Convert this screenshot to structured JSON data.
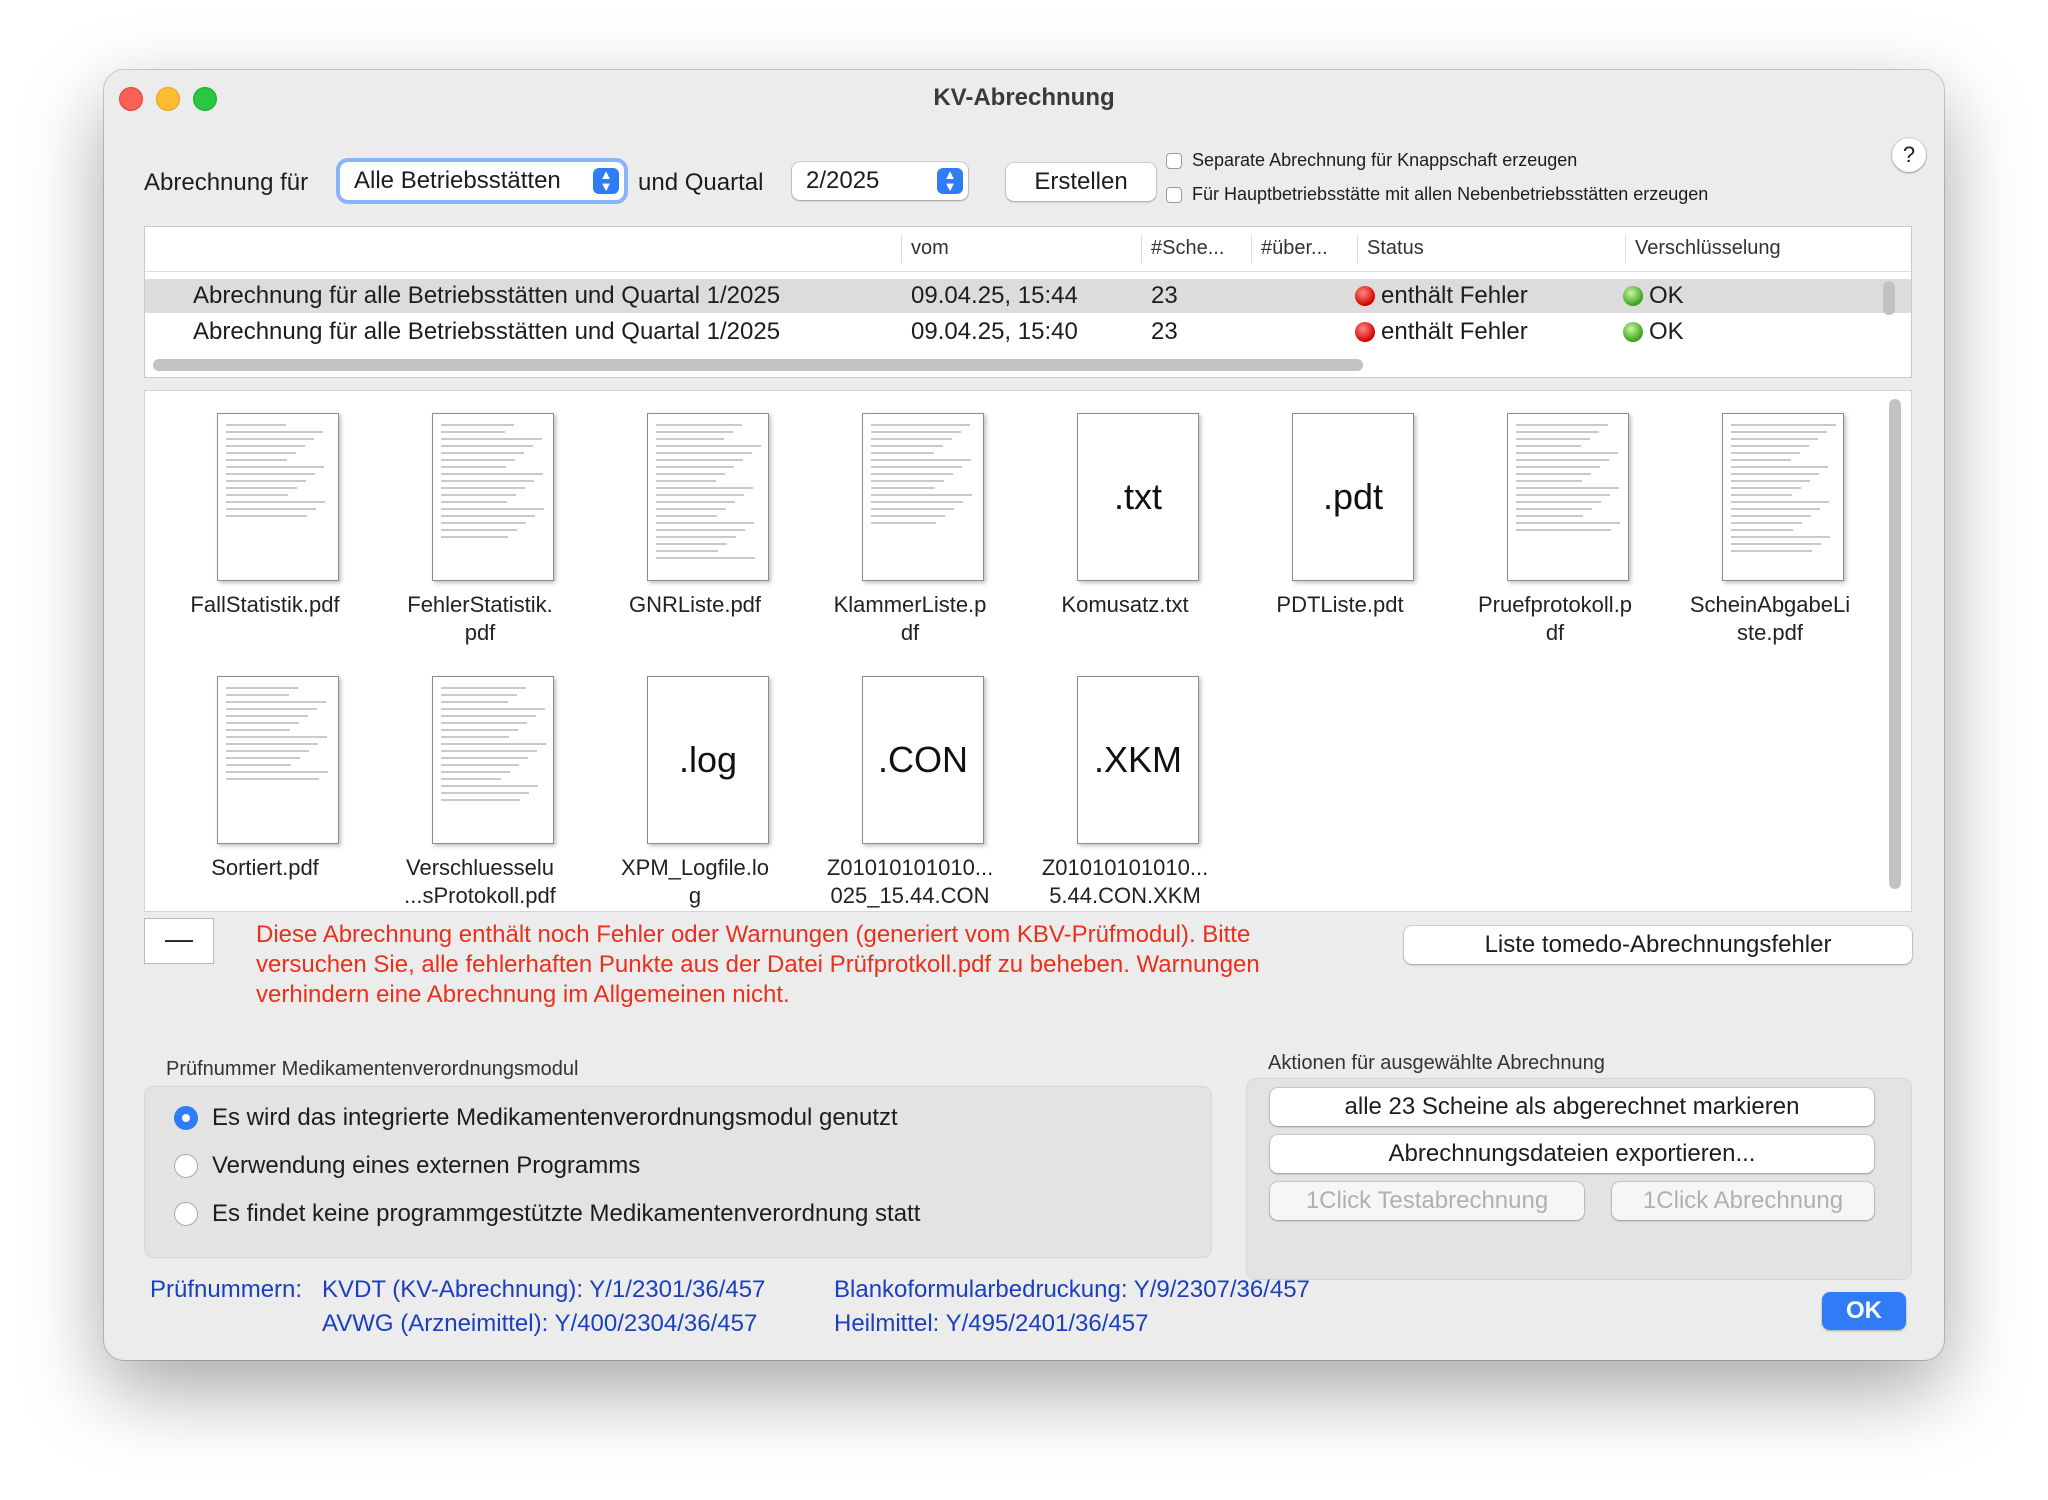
{
  "window": {
    "title": "KV-Abrechnung"
  },
  "toolbar": {
    "abrechnung_label": "Abrechnung für",
    "betriebsstaette_value": "Alle Betriebsstätten",
    "quartal_label": "und Quartal",
    "quartal_value": "2/2025",
    "create_button": "Erstellen",
    "checkbox_knappschaft": "Separate Abrechnung für Knappschaft erzeugen",
    "checkbox_haupt": "Für Hauptbetriebsstätte mit allen Nebenbetriebsstätten erzeugen",
    "help": "?"
  },
  "table": {
    "headers": [
      "vom",
      "#Sche...",
      "#über...",
      "Status",
      "Verschlüsselung"
    ],
    "rows": [
      {
        "name": "Abrechnung für alle Betriebsstätten und Quartal 1/2025",
        "vom": "09.04.25, 15:44",
        "scheine": "23",
        "ueber": "",
        "status": "enthält Fehler",
        "verschluesselung": "OK"
      },
      {
        "name": "Abrechnung für alle Betriebsstätten und Quartal 1/2025",
        "vom": "09.04.25, 15:40",
        "scheine": "23",
        "ueber": "",
        "status": "enthält Fehler",
        "verschluesselung": "OK"
      }
    ]
  },
  "files": [
    {
      "name": "FallStatistik.pdf",
      "ext": "",
      "icon": "pdf-preview-icon"
    },
    {
      "name": "FehlerStatistik.\npdf",
      "ext": "",
      "icon": "pdf-preview-icon"
    },
    {
      "name": "GNRListe.pdf",
      "ext": "",
      "icon": "pdf-preview-icon"
    },
    {
      "name": "KlammerListe.p\ndf",
      "ext": "",
      "icon": "pdf-preview-icon"
    },
    {
      "name": "Komusatz.txt",
      "ext": ".txt",
      "icon": "text-file-icon"
    },
    {
      "name": "PDTListe.pdt",
      "ext": ".pdt",
      "icon": "pdt-file-icon"
    },
    {
      "name": "Pruefprotokoll.p\ndf",
      "ext": "",
      "icon": "pdf-preview-icon"
    },
    {
      "name": "ScheinAbgabeLi\nste.pdf",
      "ext": "",
      "icon": "pdf-preview-icon"
    },
    {
      "name": "Sortiert.pdf",
      "ext": "",
      "icon": "pdf-preview-icon"
    },
    {
      "name": "Verschluesselu\n...sProtokoll.pdf",
      "ext": "",
      "icon": "pdf-preview-icon"
    },
    {
      "name": "XPM_Logfile.lo\ng",
      "ext": ".log",
      "icon": "log-file-icon"
    },
    {
      "name": "Z01010101010...\n025_15.44.CON",
      "ext": ".CON",
      "icon": "con-file-icon"
    },
    {
      "name": "Z01010101010...\n5.44.CON.XKM",
      "ext": ".XKM",
      "icon": "xkm-file-icon"
    }
  ],
  "remove_button": "—",
  "warning_text": "Diese Abrechnung enthält noch Fehler oder Warnungen (generiert vom KBV-Prüfmodul). Bitte versuchen Sie, alle fehlerhaften Punkte aus der Datei Prüfprotkoll.pdf zu beheben. Warnungen verhindern eine Abrechnung im Allgemeinen nicht.",
  "error_list_button": "Liste tomedo-Abrechnungsfehler",
  "med_module": {
    "title": "Prüfnummer Medikamentenverordnungsmodul",
    "options": [
      "Es wird das integrierte Medikamentenverordnungsmodul genutzt",
      "Verwendung eines externen Programms",
      "Es findet keine programmgestützte Medikamentenverordnung statt"
    ],
    "selected_index": 0
  },
  "actions": {
    "title": "Aktionen für ausgewählte Abrechnung",
    "mark_button": "alle 23 Scheine als abgerechnet markieren",
    "export_button": "Abrechnungsdateien exportieren...",
    "test_button": "1Click Testabrechnung",
    "oneclick_button": "1Click Abrechnung"
  },
  "pruefnummern": {
    "label": "Prüfnummern:",
    "kvdt": "KVDT (KV-Abrechnung): Y/1/2301/36/457",
    "avwg": "AVWG (Arzneimittel): Y/400/2304/36/457",
    "blanko": "Blankoformularbedruckung: Y/9/2307/36/457",
    "heilmittel": "Heilmittel: Y/495/2401/36/457"
  },
  "ok_button": "OK",
  "colors": {
    "accent": "#2f7cf6",
    "warning": "#e8301c",
    "info_blue": "#1a3fbf",
    "status_error": "#d50000",
    "status_ok": "#3aa11a"
  }
}
